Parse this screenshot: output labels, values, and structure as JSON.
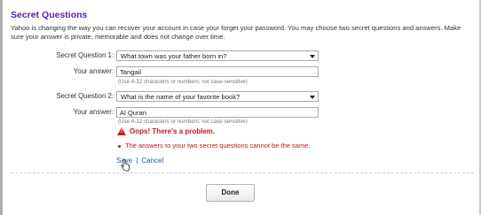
{
  "title": "Secret Questions",
  "intro": "Yahoo is changing the way you can recover your account in case your forget your password. You may choose two secret questions and answers. Make sure your answer is private, memorable and does not change over time.",
  "q1": {
    "label": "Secret Question 1:",
    "selected": "What town was your father born in?",
    "answer_label": "Your answer:",
    "answer_value": "Tangail",
    "hint": "(Use 4-32 characters or numbers; not case-sensitive)"
  },
  "q2": {
    "label": "Secret Question 2:",
    "selected": "What is the name of your favorite book?",
    "answer_label": "Your answer:",
    "answer_value": "Al Quran",
    "hint": "(Use 4-32 characters or numbers; not case-sensitive)"
  },
  "error": {
    "heading": "Oops! There's a problem.",
    "message": "The answers to your two secret questions cannot be the same."
  },
  "actions": {
    "save": "Save",
    "separator": "|",
    "cancel": "Cancel"
  },
  "done_label": "Done"
}
